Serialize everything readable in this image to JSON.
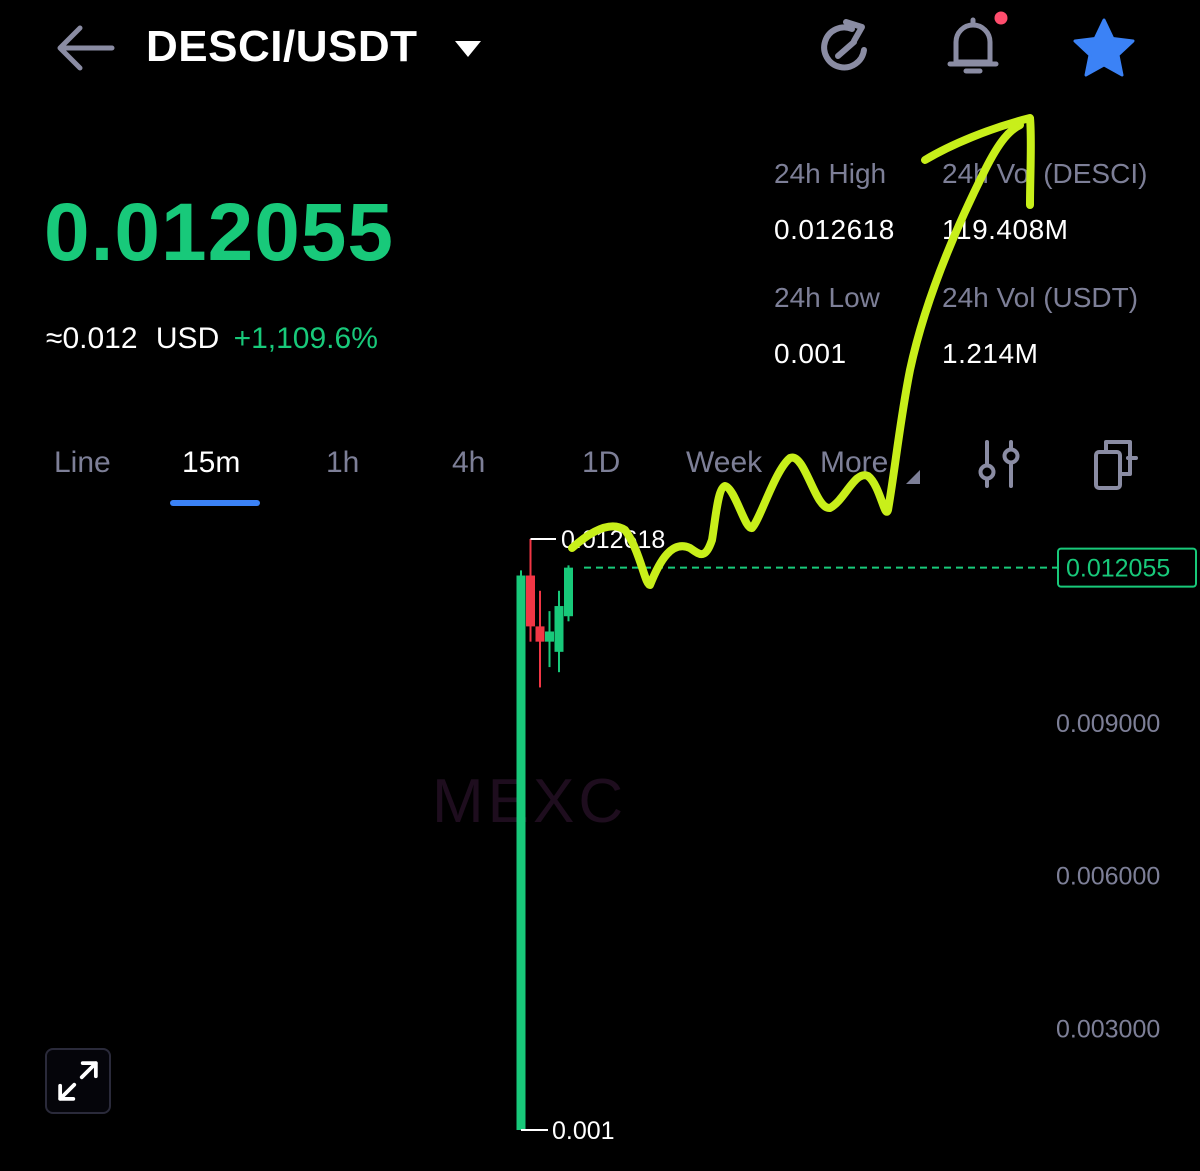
{
  "header": {
    "pair": "DESCI/USDT",
    "icons": {
      "back": "arrow-left-icon",
      "caret": "caret-down-icon",
      "refresh": "refresh-icon",
      "alert": "bell-icon",
      "favorite": "star-icon"
    },
    "alert_dot_color": "#ff4d6d",
    "favorite_color": "#3b82f6"
  },
  "price": {
    "last": "0.012055",
    "approx": "≈0.012",
    "approx_unit": "USD",
    "change": "+1,109.6%",
    "color": "#18c97a"
  },
  "stats": {
    "high_label": "24h High",
    "high_value": "0.012618",
    "vol_base_label": "24h Vol (DESCI)",
    "vol_base_value": "119.408M",
    "low_label": "24h Low",
    "low_value": "0.001",
    "vol_quote_label": "24h Vol  (USDT)",
    "vol_quote_value": "1.214M"
  },
  "tabs": {
    "items": [
      "Line",
      "15m",
      "1h",
      "4h",
      "1D",
      "Week",
      "More"
    ],
    "active": "15m"
  },
  "chart": {
    "watermark": "MEXC",
    "high_marker": "0.012618",
    "low_marker": "0.001",
    "current_price_tag": "0.012055",
    "y_axis_labels": [
      "0.009000",
      "0.006000",
      "0.003000"
    ],
    "colors": {
      "up": "#18c97a",
      "down": "#f23645"
    }
  },
  "chart_data": {
    "type": "candlestick",
    "y_ticks": [
      0.009,
      0.006,
      0.003
    ],
    "last_price": 0.012055,
    "high": 0.012618,
    "low": 0.001,
    "candles": [
      {
        "open": 0.001,
        "high": 0.012,
        "low": 0.001,
        "close": 0.0119
      },
      {
        "open": 0.0119,
        "high": 0.012618,
        "low": 0.0106,
        "close": 0.0109
      },
      {
        "open": 0.0109,
        "high": 0.0116,
        "low": 0.0097,
        "close": 0.0106
      },
      {
        "open": 0.0106,
        "high": 0.0112,
        "low": 0.0101,
        "close": 0.0108
      },
      {
        "open": 0.0104,
        "high": 0.0116,
        "low": 0.01,
        "close": 0.0113
      },
      {
        "open": 0.0111,
        "high": 0.0121,
        "low": 0.011,
        "close": 0.012055
      }
    ]
  }
}
